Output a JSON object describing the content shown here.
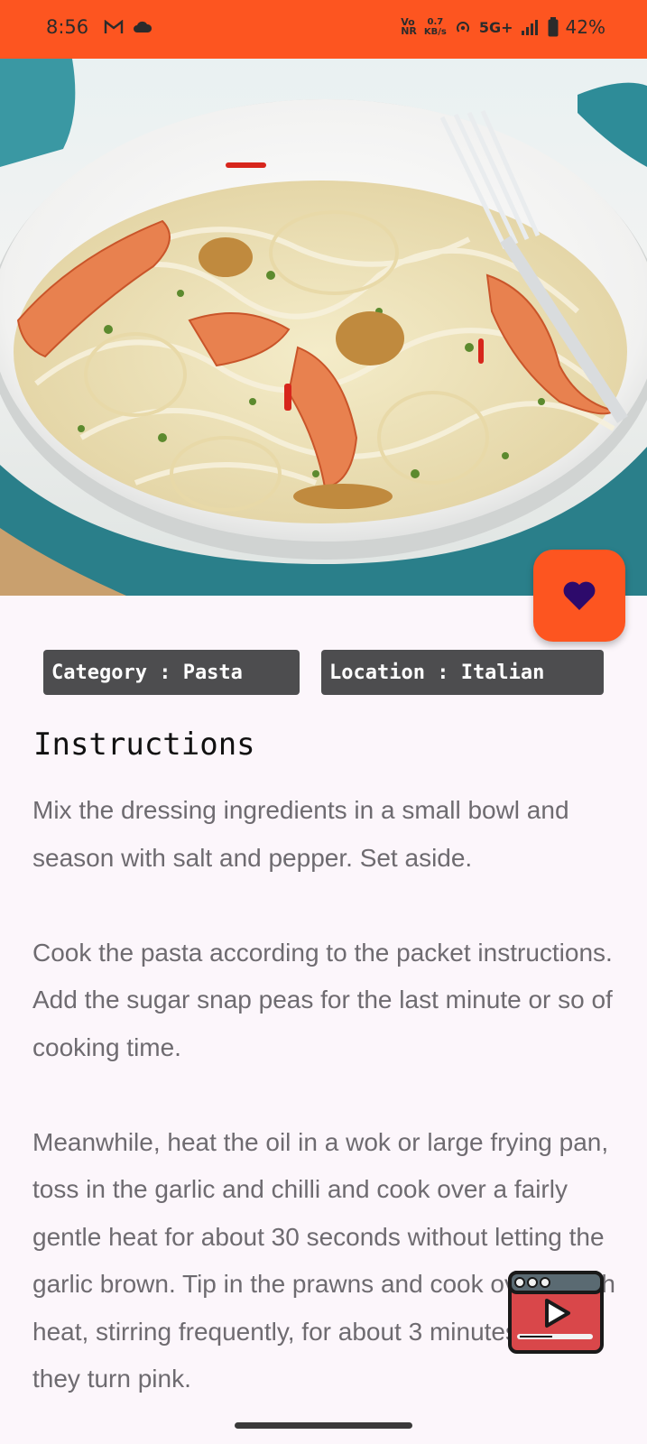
{
  "status_bar": {
    "time": "8:56",
    "net_speed_value": "0.7",
    "net_speed_unit": "KB/s",
    "network": "5G+",
    "battery": "42%",
    "volte_top": "Vo",
    "volte_bottom": "NR"
  },
  "recipe": {
    "category_chip": "Category : Pasta",
    "location_chip": "Location : Italian",
    "instructions_heading": "Instructions",
    "instructions": "Mix the dressing ingredients in a small bowl and season with salt and pepper. Set aside.\n\nCook the pasta according to the packet instructions. Add the sugar snap peas for the last minute or so of cooking time.\n\nMeanwhile, heat the oil in a wok or large frying pan, toss in the garlic and chilli and cook over a fairly gentle heat for about 30 seconds without letting the garlic brown. Tip in the prawns and cook over a high heat, stirring frequently, for about 3 minutes until they turn pink."
  },
  "icons": {
    "favorite": "heart-icon",
    "video": "video-player-icon",
    "gmail": "gmail-icon",
    "cloud": "cloud-icon"
  },
  "colors": {
    "accent": "#fd5520",
    "chip_bg": "#4d4d4f",
    "heart": "#2d0a6b",
    "page_bg": "#fcf6fb"
  }
}
